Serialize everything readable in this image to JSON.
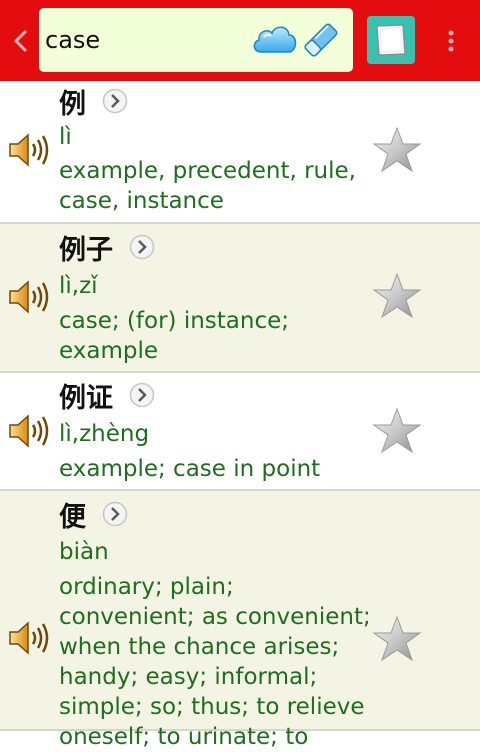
{
  "search": {
    "value": "case"
  },
  "icons": {
    "back": "chevron-left-icon",
    "cloud": "cloud-icon",
    "eraser": "eraser-icon",
    "notes": "notes-icon",
    "menu": "more-vert-icon",
    "speaker": "speaker-icon",
    "detail": "chevron-right-circle-icon",
    "star": "star-icon"
  },
  "colors": {
    "toolbar": "#e30d10",
    "search_bg": "#f3ffd9",
    "notes_bg": "#3ac0b0",
    "entry_alt_bg": "#f3f4e3",
    "text_green": "#1f6e1f"
  },
  "results": [
    {
      "hanzi": "例",
      "pinyin": "lì",
      "definition": "example, precedent, rule, case, instance"
    },
    {
      "hanzi": "例子",
      "pinyin": "lì,zǐ",
      "definition": "case; (for) instance; example"
    },
    {
      "hanzi": "例证",
      "pinyin": "lì,zhèng",
      "definition": "example; case in point"
    },
    {
      "hanzi": "便",
      "pinyin": "biàn",
      "definition": "ordinary; plain; convenient; as convenient; when the chance arises; handy; easy; informal; simple; so; thus; to relieve oneself; to urinate; to"
    }
  ]
}
